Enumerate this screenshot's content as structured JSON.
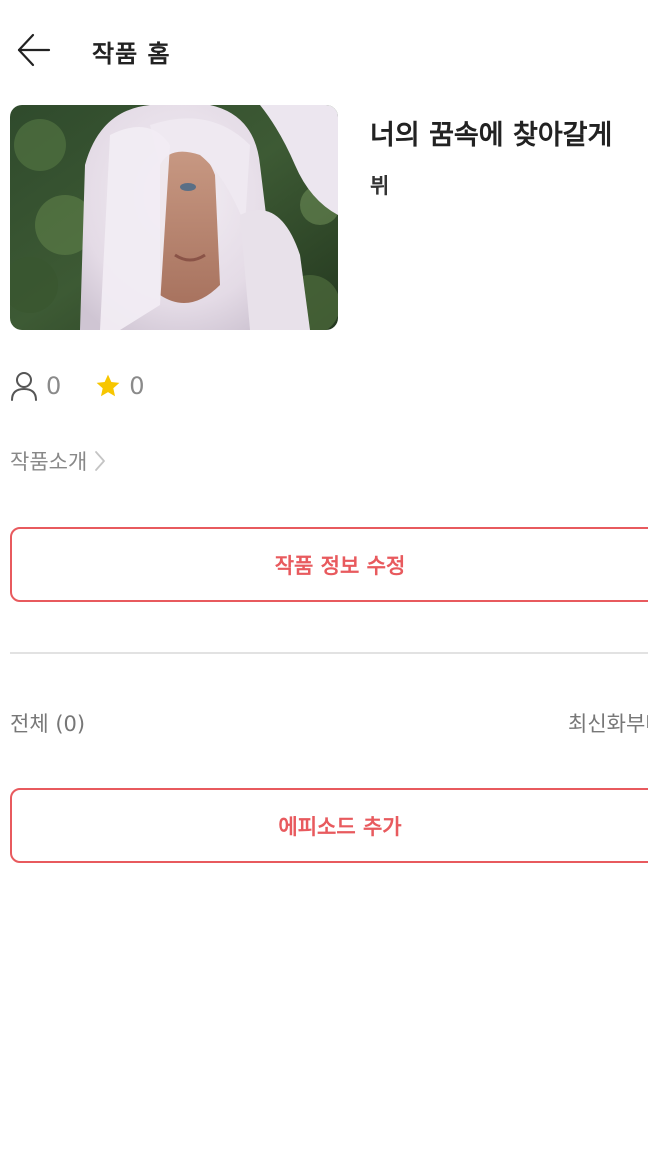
{
  "header": {
    "back_icon": "arrow-left-icon",
    "title": "작품 홈"
  },
  "work": {
    "title": "너의 꿈속에 찾아갈게",
    "author": "뷔",
    "cover_image": "cover-photo"
  },
  "stats": {
    "readers_icon": "person-icon",
    "readers": "0",
    "rating_icon": "star-icon",
    "rating": "0"
  },
  "intro": {
    "label": "작품소개",
    "icon": "chevron-right-icon"
  },
  "buttons": {
    "edit_info": "작품 정보 수정",
    "add_episode": "에피소드 추가"
  },
  "episodes": {
    "count_label": "전체 (0)",
    "sort_label": "최신화부터"
  },
  "colors": {
    "accent": "#e85a5e",
    "star": "#f7c600",
    "muted_text": "#888888",
    "divider": "#e2e2e2"
  }
}
